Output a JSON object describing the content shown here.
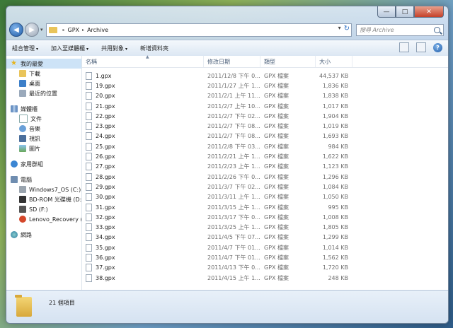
{
  "window": {
    "caption": {
      "minimize": "—",
      "maximize": "□",
      "close": "✕"
    },
    "nav": {
      "back": "◀",
      "forward": "▶",
      "dropdown": "▾"
    }
  },
  "address": {
    "crumbs": [
      "GPX",
      "Archive"
    ],
    "sep": "▸",
    "dropdown": "▾",
    "refresh": "↻"
  },
  "search": {
    "placeholder": "搜尋 Archive"
  },
  "toolbar": {
    "items": [
      "組合管理",
      "加入至媒體櫃",
      "共用對象",
      "新增資料夾"
    ],
    "dropdown_arrow": "▾",
    "help": "?"
  },
  "sidebar": {
    "favorites": {
      "label": "我的最愛",
      "items": [
        "下載",
        "桌面",
        "最近的位置"
      ]
    },
    "libraries": {
      "label": "媒體櫃",
      "items": [
        "文件",
        "音樂",
        "視訊",
        "圖片"
      ]
    },
    "homegroup": {
      "label": "家用群組"
    },
    "computer": {
      "label": "電腦",
      "items": [
        "Windows7_OS (C:)",
        "BD-ROM 光碟機 (D:)",
        "SD (F:)",
        "Lenovo_Recovery (Q:)"
      ]
    },
    "network": {
      "label": "網路"
    }
  },
  "columns": {
    "name": "名稱",
    "date": "修改日期",
    "type": "類型",
    "size": "大小",
    "sort": "▲"
  },
  "files": [
    {
      "name": "1.gpx",
      "date": "2011/12/8 下午 0...",
      "type": "GPX 檔案",
      "size": "44,537 KB"
    },
    {
      "name": "19.gpx",
      "date": "2011/1/27 上午 1...",
      "type": "GPX 檔案",
      "size": "1,836 KB"
    },
    {
      "name": "20.gpx",
      "date": "2011/2/1 上午 11...",
      "type": "GPX 檔案",
      "size": "1,838 KB"
    },
    {
      "name": "21.gpx",
      "date": "2011/2/7 上午 10...",
      "type": "GPX 檔案",
      "size": "1,017 KB"
    },
    {
      "name": "22.gpx",
      "date": "2011/2/7 下午 02...",
      "type": "GPX 檔案",
      "size": "1,904 KB"
    },
    {
      "name": "23.gpx",
      "date": "2011/2/7 下午 08...",
      "type": "GPX 檔案",
      "size": "1,019 KB"
    },
    {
      "name": "24.gpx",
      "date": "2011/2/7 下午 08...",
      "type": "GPX 檔案",
      "size": "1,693 KB"
    },
    {
      "name": "25.gpx",
      "date": "2011/2/8 下午 03...",
      "type": "GPX 檔案",
      "size": "984 KB"
    },
    {
      "name": "26.gpx",
      "date": "2011/2/21 上午 1...",
      "type": "GPX 檔案",
      "size": "1,622 KB"
    },
    {
      "name": "27.gpx",
      "date": "2011/2/23 上午 1...",
      "type": "GPX 檔案",
      "size": "1,123 KB"
    },
    {
      "name": "28.gpx",
      "date": "2011/2/26 下午 0...",
      "type": "GPX 檔案",
      "size": "1,296 KB"
    },
    {
      "name": "29.gpx",
      "date": "2011/3/7 下午 02...",
      "type": "GPX 檔案",
      "size": "1,084 KB"
    },
    {
      "name": "30.gpx",
      "date": "2011/3/11 上午 1...",
      "type": "GPX 檔案",
      "size": "1,050 KB"
    },
    {
      "name": "31.gpx",
      "date": "2011/3/15 上午 1...",
      "type": "GPX 檔案",
      "size": "995 KB"
    },
    {
      "name": "32.gpx",
      "date": "2011/3/17 下午 0...",
      "type": "GPX 檔案",
      "size": "1,008 KB"
    },
    {
      "name": "33.gpx",
      "date": "2011/3/25 上午 1...",
      "type": "GPX 檔案",
      "size": "1,805 KB"
    },
    {
      "name": "34.gpx",
      "date": "2011/4/5 下午 07...",
      "type": "GPX 檔案",
      "size": "1,299 KB"
    },
    {
      "name": "35.gpx",
      "date": "2011/4/7 下午 01...",
      "type": "GPX 檔案",
      "size": "1,014 KB"
    },
    {
      "name": "36.gpx",
      "date": "2011/4/7 下午 01...",
      "type": "GPX 檔案",
      "size": "1,562 KB"
    },
    {
      "name": "37.gpx",
      "date": "2011/4/13 下午 0...",
      "type": "GPX 檔案",
      "size": "1,720 KB"
    },
    {
      "name": "38.gpx",
      "date": "2011/4/15 上午 1...",
      "type": "GPX 檔案",
      "size": "248 KB"
    }
  ],
  "status": {
    "count": "21 個項目"
  }
}
